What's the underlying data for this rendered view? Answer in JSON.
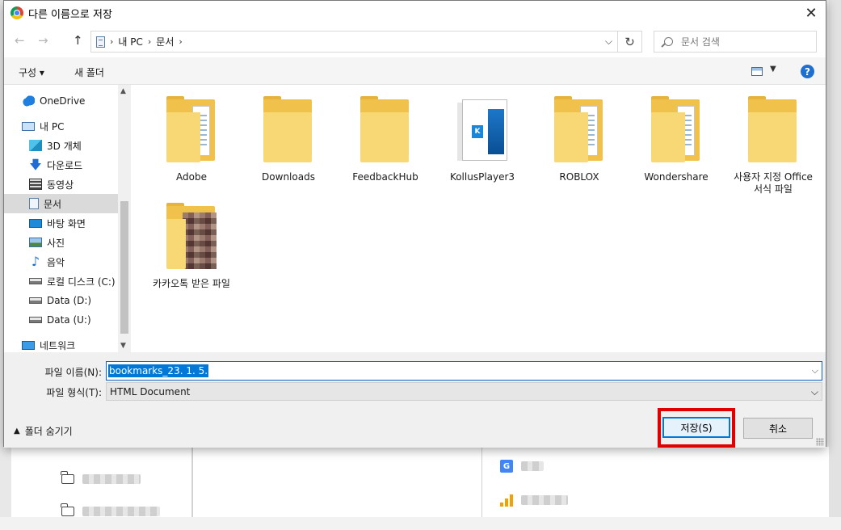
{
  "dialog": {
    "title": "다른 이름으로 저장",
    "close_label": "✕"
  },
  "address": {
    "crumbs": [
      "내 PC",
      "문서"
    ],
    "search_placeholder": "문서 검색"
  },
  "toolbar": {
    "organize_label": "구성 ▾",
    "new_folder_label": "새 폴더",
    "help_label": "?"
  },
  "sidebar": {
    "items": [
      {
        "label": "OneDrive",
        "icon": "cloud-icon"
      },
      {
        "label": "내 PC",
        "icon": "computer-icon"
      },
      {
        "label": "3D 개체",
        "icon": "cube-icon"
      },
      {
        "label": "다운로드",
        "icon": "download-icon"
      },
      {
        "label": "동영상",
        "icon": "video-icon"
      },
      {
        "label": "문서",
        "icon": "document-icon",
        "selected": true
      },
      {
        "label": "바탕 화면",
        "icon": "desktop-icon"
      },
      {
        "label": "사진",
        "icon": "picture-icon"
      },
      {
        "label": "음악",
        "icon": "music-icon"
      },
      {
        "label": "로컬 디스크 (C:)",
        "icon": "drive-icon"
      },
      {
        "label": "Data (D:)",
        "icon": "drive-icon"
      },
      {
        "label": "Data (U:)",
        "icon": "drive-icon"
      },
      {
        "label": "네트워크",
        "icon": "network-icon"
      }
    ]
  },
  "files": [
    {
      "name": "Adobe",
      "kind": "folder"
    },
    {
      "name": "Downloads",
      "kind": "folder"
    },
    {
      "name": "FeedbackHub",
      "kind": "folder"
    },
    {
      "name": "KollusPlayer3",
      "kind": "app-folder"
    },
    {
      "name": "ROBLOX",
      "kind": "folder"
    },
    {
      "name": "Wondershare",
      "kind": "folder"
    },
    {
      "name": "사용자 지정 Office 서식 파일",
      "kind": "folder"
    },
    {
      "name": "카카오톡 받은 파일",
      "kind": "image-folder"
    }
  ],
  "form": {
    "filename_label": "파일 이름(N):",
    "filename_value": "bookmarks_23. 1. 5.",
    "filetype_label": "파일 형식(T):",
    "filetype_value": "HTML Document",
    "hide_folders_label": "폴더 숨기기",
    "save_label": "저장(S)",
    "cancel_label": "취소"
  },
  "colors": {
    "accent": "#0078d7",
    "highlight_box": "#e00000",
    "folder": "#f8d775"
  }
}
